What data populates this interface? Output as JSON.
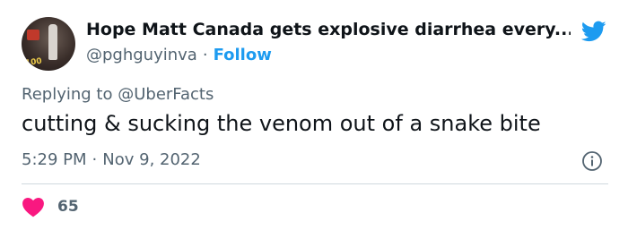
{
  "tweet": {
    "author_name": "Hope Matt Canada gets explosive diarrhea every...",
    "handle": "@pghguyinva",
    "separator": "·",
    "follow_label": "Follow",
    "replying_prefix": "Replying to",
    "replying_to": "@UberFacts",
    "text": "cutting & sucking the venom out of a snake bite",
    "time": "5:29 PM",
    "date": "Nov 9, 2022",
    "like_count": "65",
    "avatar_badge": "100"
  },
  "icons": {
    "brand": "twitter-bird-icon",
    "info": "info-icon",
    "like": "heart-icon"
  },
  "colors": {
    "accent": "#1d9bf0",
    "like": "#f91880",
    "muted": "#536471",
    "text": "#0f1419",
    "divider": "#cfd9de"
  }
}
